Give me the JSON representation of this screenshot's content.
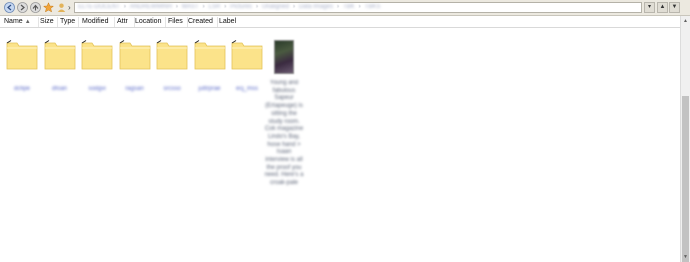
{
  "toolbar": {
    "path_segments": [
      "ELTE-DOCENT",
      "ANDREWMINH",
      "MAST",
      "LSR",
      "Pictures",
      "Unaligned",
      "Data Images",
      "TBK",
      "TBKS"
    ],
    "home_arrow": "›",
    "dropdown_glyph": "▾",
    "up_glyph": "▲",
    "min_glyph": "▲",
    "max_glyph": "▼"
  },
  "columns": [
    {
      "label": "Name",
      "sort": "▲"
    },
    {
      "label": "Size"
    },
    {
      "label": "Type"
    },
    {
      "label": "Modified"
    },
    {
      "label": "Attr"
    },
    {
      "label": "Location"
    },
    {
      "label": "Files"
    },
    {
      "label": "Created"
    },
    {
      "label": "Label"
    }
  ],
  "folders": [
    "dcfipe",
    "dfoan",
    "sodgvi",
    "ragsan",
    "srcsso",
    "juttrprae",
    "ecj_mss"
  ],
  "image_file": {
    "label": "Young and fabulous Sapeur (Ertapeuge) is sitting the study room. Cok magazine Lindo's Bay, hose hand > Isaan interview is all the proof you need. Here's a croak-pale"
  },
  "scroll": {
    "up_glyph": "▲",
    "down_glyph": "▼"
  },
  "colors": {
    "folder_fill": "#fbe38a",
    "folder_edge": "#e4c35a",
    "toolbar_bg": "#ece9e0",
    "scroll_thumb": "#c2c2c2"
  }
}
